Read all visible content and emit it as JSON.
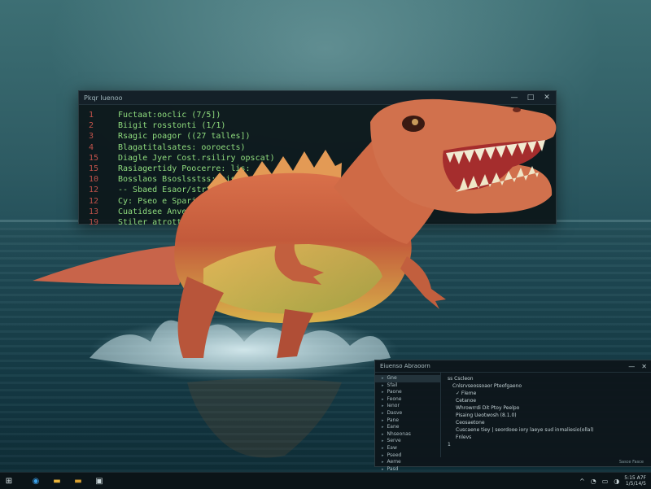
{
  "code_window": {
    "title": "Pkqr Iuenoo",
    "controls": [
      "—",
      "□",
      "✕"
    ],
    "lines": [
      {
        "num": "1",
        "text": "Fuctaat:ooclic (7/5])"
      },
      {
        "num": "2",
        "text": "Biigit rosstonti (1/1)"
      },
      {
        "num": "3",
        "text": "Rsagic poagor ((27 talles])"
      },
      {
        "num": "4",
        "text": "Blagatitalsates: ooroects)"
      },
      {
        "num": "15",
        "text": "Diagle Jyer Cost.rsiliry opscat)"
      },
      {
        "num": "15",
        "text": "Rasiagertidy Poocerre: lis:"
      },
      {
        "num": "10",
        "text": "Bosslaos Bsoslsstss:(sis:):"
      },
      {
        "num": "12",
        "text": "-- Sbaed Esaor/strtile"
      },
      {
        "num": "12",
        "text": "Cy: Pseo e Sparias:"
      },
      {
        "num": "13",
        "text": "Cuatidsee Anverag"
      },
      {
        "num": "19",
        "text": "Stiler atrottom"
      }
    ]
  },
  "explorer": {
    "title": "Eiuenso Abraoorn",
    "controls": [
      "—",
      "✕"
    ],
    "sidebar": [
      "Gne",
      "Sfail",
      "Paone",
      "Feone",
      "Ienor",
      "Dasve",
      "Pane",
      "Eane",
      "Nhseonas",
      "Serve",
      "Eaw",
      "Pseed",
      "Aeme",
      "Pasd"
    ],
    "main_header": "ss Cscleon",
    "main_rows": [
      "Cnlsrvseossoaor Pteofgaeno",
      "✓ Fleme",
      "Cetanoe",
      "Whrowrrdi Dit Ptoy Peelpo",
      "Pisaing Ueotwosh (8.1.0)",
      "Ceosaetone",
      "Cuscaene tiey | seordooe iory laeye sud inmaliesio(ollal)",
      "Fnlevs",
      "1"
    ],
    "status": "Sasce Fasce"
  },
  "taskbar": {
    "start_glyph": "⊞",
    "apps": [
      {
        "name": "browser",
        "glyph": "◉",
        "color": "#3aa0e8"
      },
      {
        "name": "files",
        "glyph": "▬",
        "color": "#e9b43a"
      },
      {
        "name": "folder",
        "glyph": "▬",
        "color": "#d9a030"
      },
      {
        "name": "terminal",
        "glyph": "▣",
        "color": "#c9d6d9"
      }
    ],
    "tray_icons": [
      "^",
      "◔",
      "▭",
      "◑"
    ],
    "clock_time": "5:15 A7F",
    "clock_date": "1/5/14/5"
  }
}
